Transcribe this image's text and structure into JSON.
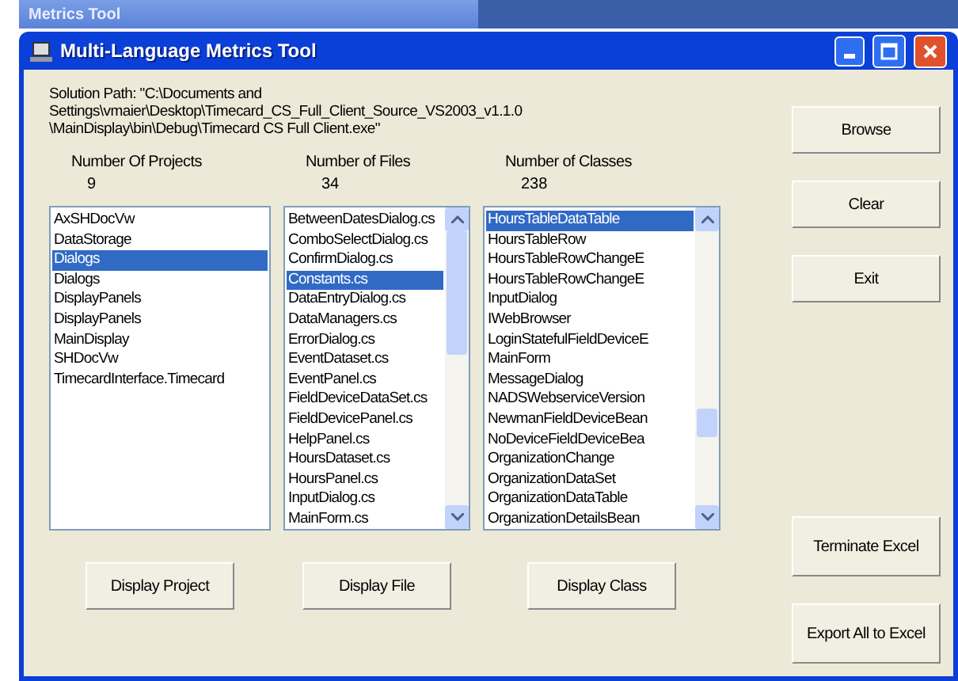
{
  "background_window": {
    "title": "Metrics Tool"
  },
  "window": {
    "title": "Multi-Language Metrics Tool"
  },
  "solution_path": {
    "lines": [
      "Solution Path: \"C:\\Documents and",
      "Settings\\vmaier\\Desktop\\Timecard_CS_Full_Client_Source_VS2003_v1.1.0",
      "\\MainDisplay\\bin\\Debug\\Timecard CS Full Client.exe\""
    ]
  },
  "columns": [
    {
      "label": "Number Of Projects",
      "count": "9",
      "button": "Display Project",
      "scrollbar": false,
      "items": [
        {
          "text": "AxSHDocVw",
          "selected": false
        },
        {
          "text": "DataStorage",
          "selected": false
        },
        {
          "text": "Dialogs",
          "selected": true
        },
        {
          "text": "Dialogs",
          "selected": false
        },
        {
          "text": "DisplayPanels",
          "selected": false
        },
        {
          "text": "DisplayPanels",
          "selected": false
        },
        {
          "text": "MainDisplay",
          "selected": false
        },
        {
          "text": "SHDocVw",
          "selected": false
        },
        {
          "text": "TimecardInterface.Timecard",
          "selected": false
        }
      ]
    },
    {
      "label": "Number of Files",
      "count": "34",
      "button": "Display File",
      "scrollbar": true,
      "items": [
        {
          "text": "BetweenDatesDialog.cs",
          "selected": false
        },
        {
          "text": "ComboSelectDialog.cs",
          "selected": false
        },
        {
          "text": "ConfirmDialog.cs",
          "selected": false
        },
        {
          "text": "Constants.cs",
          "selected": true
        },
        {
          "text": "DataEntryDialog.cs",
          "selected": false
        },
        {
          "text": "DataManagers.cs",
          "selected": false
        },
        {
          "text": "ErrorDialog.cs",
          "selected": false
        },
        {
          "text": "EventDataset.cs",
          "selected": false
        },
        {
          "text": "EventPanel.cs",
          "selected": false
        },
        {
          "text": "FieldDeviceDataSet.cs",
          "selected": false
        },
        {
          "text": "FieldDevicePanel.cs",
          "selected": false
        },
        {
          "text": "HelpPanel.cs",
          "selected": false
        },
        {
          "text": "HoursDataset.cs",
          "selected": false
        },
        {
          "text": "HoursPanel.cs",
          "selected": false
        },
        {
          "text": "InputDialog.cs",
          "selected": false
        },
        {
          "text": "MainForm.cs",
          "selected": false
        }
      ]
    },
    {
      "label": "Number of Classes",
      "count": "238",
      "button": "Display Class",
      "scrollbar": true,
      "items": [
        {
          "text": "HoursTableDataTable",
          "selected": true
        },
        {
          "text": "HoursTableRow",
          "selected": false
        },
        {
          "text": "HoursTableRowChangeE",
          "selected": false
        },
        {
          "text": "HoursTableRowChangeE",
          "selected": false
        },
        {
          "text": "InputDialog",
          "selected": false
        },
        {
          "text": "IWebBrowser",
          "selected": false
        },
        {
          "text": "LoginStatefulFieldDeviceE",
          "selected": false
        },
        {
          "text": "MainForm",
          "selected": false
        },
        {
          "text": "MessageDialog",
          "selected": false
        },
        {
          "text": "NADSWebserviceVersion",
          "selected": false
        },
        {
          "text": "NewmanFieldDeviceBean",
          "selected": false
        },
        {
          "text": "NoDeviceFieldDeviceBea",
          "selected": false
        },
        {
          "text": "OrganizationChange",
          "selected": false
        },
        {
          "text": "OrganizationDataSet",
          "selected": false
        },
        {
          "text": "OrganizationDataTable",
          "selected": false
        },
        {
          "text": "OrganizationDetailsBean",
          "selected": false
        }
      ]
    }
  ],
  "side_buttons": {
    "top": [
      "Browse",
      "Clear",
      "Exit"
    ],
    "bottom": [
      "Terminate Excel",
      "Export All to Excel"
    ]
  }
}
